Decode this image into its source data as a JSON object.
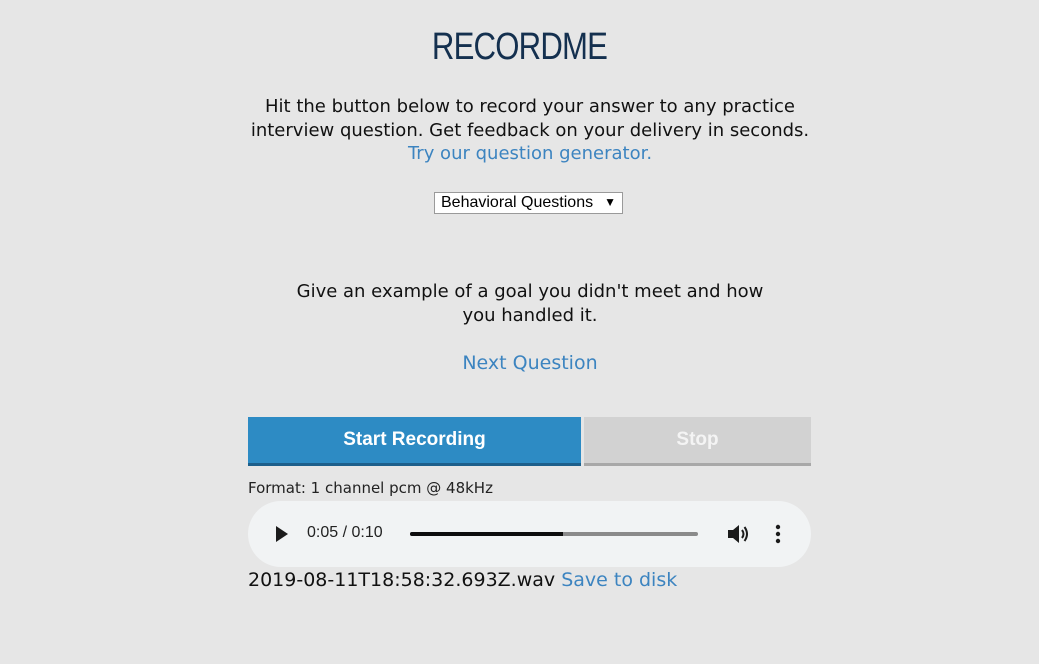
{
  "app": {
    "title": "RECORDME"
  },
  "intro": {
    "text": "Hit the button below to record your answer to any practice interview question. Get feedback on your delivery in seconds.",
    "generator_link": "Try our question generator."
  },
  "category_select": {
    "selected": "Behavioral Questions"
  },
  "question": {
    "text": "Give an example of a goal you didn't meet and how you handled it.",
    "next_label": "Next Question"
  },
  "controls": {
    "start_label": "Start Recording",
    "stop_label": "Stop",
    "stop_enabled": false
  },
  "recording": {
    "format": "Format: 1 channel pcm @ 48kHz",
    "player": {
      "time": "0:05 / 0:10",
      "progress": 0.53
    },
    "filename": "2019-08-11T18:58:32.693Z.wav",
    "save_label": "Save to disk"
  },
  "colors": {
    "background": "#e6e6e6",
    "title": "#14304f",
    "link": "#3c84c0",
    "primary_button": "#2d8bc4",
    "disabled_button": "#d2d2d2"
  },
  "icons": {
    "play": "play-icon",
    "volume": "volume-icon",
    "more": "more-vertical-icon",
    "dropdown": "dropdown-arrow-icon"
  }
}
